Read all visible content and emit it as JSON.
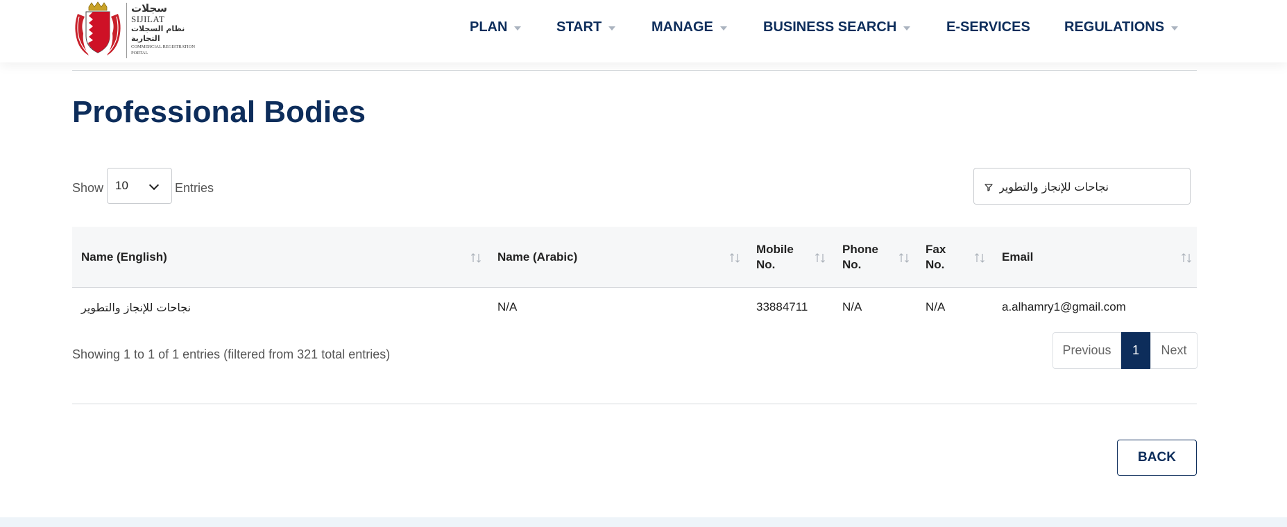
{
  "logo": {
    "arabic_title": "سجلات",
    "english_title": "SIJILAT",
    "arabic_subtitle_1": "نظام السجلات",
    "arabic_subtitle_2": "التجارية",
    "subtitle": "COMMERCIAL REGISTRATION PORTAL"
  },
  "nav": {
    "items": [
      {
        "label": "PLAN",
        "dropdown": true
      },
      {
        "label": "START",
        "dropdown": true
      },
      {
        "label": "MANAGE",
        "dropdown": true
      },
      {
        "label": "BUSINESS SEARCH",
        "dropdown": true
      },
      {
        "label": "E-SERVICES",
        "dropdown": false
      },
      {
        "label": "REGULATIONS",
        "dropdown": true
      }
    ]
  },
  "page": {
    "title": "Professional Bodies"
  },
  "controls": {
    "show_label": "Show",
    "entries_value": "10",
    "entries_label": "Entries",
    "filter_value": "نجاحات للإنجاز والتطوير",
    "filter_icon": "filter-icon"
  },
  "table": {
    "columns": [
      {
        "label": "Name (English)"
      },
      {
        "label": "Name (Arabic)"
      },
      {
        "label": "Mobile No."
      },
      {
        "label": "Phone No."
      },
      {
        "label": "Fax No."
      },
      {
        "label": "Email"
      }
    ],
    "rows": [
      {
        "name_english": "نجاحات للإنجاز والتطوير",
        "name_arabic": "N/A",
        "mobile": "33884711",
        "phone": "N/A",
        "fax": "N/A",
        "email": "a.alhamry1@gmail.com"
      }
    ]
  },
  "footer_info": {
    "showing_text": "Showing 1 to 1 of 1 entries (filtered from 321 total entries)"
  },
  "pagination": {
    "previous_label": "Previous",
    "current_page": "1",
    "next_label": "Next"
  },
  "actions": {
    "back_label": "BACK"
  },
  "colors": {
    "brand_navy": "#0d2d5b",
    "border": "#d5d8dc",
    "header_bg": "#f6f7f8"
  }
}
